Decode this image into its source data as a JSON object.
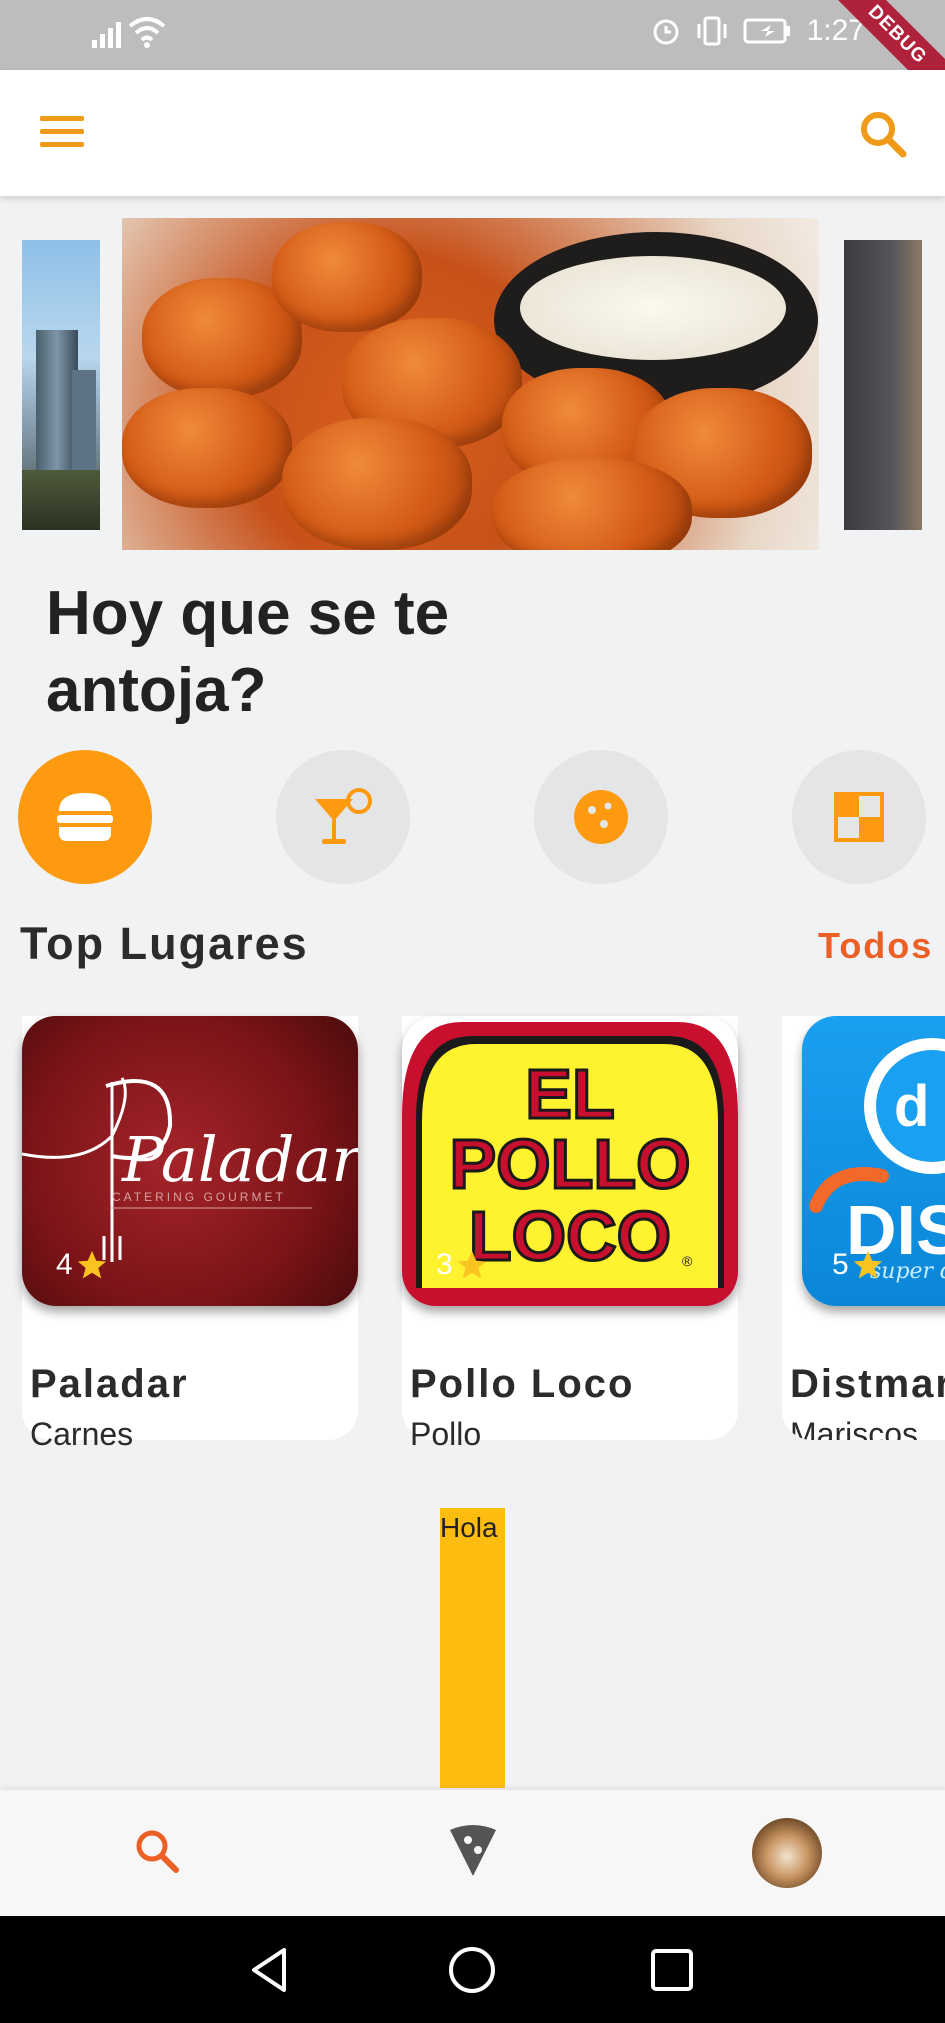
{
  "status_bar": {
    "time": "1:27",
    "debug_banner": "DEBUG",
    "icons": [
      "signal-icon",
      "wifi-icon",
      "alarm-icon",
      "vibrate-icon",
      "battery-icon"
    ]
  },
  "app_bar": {
    "icons": [
      "menu-icon",
      "search-icon"
    ],
    "accent_color": "#ef9a18"
  },
  "carousel": {
    "slides": [
      "city-skyline-image",
      "chicken-wings-image",
      "dark-image"
    ]
  },
  "headline": "Hoy que se te antoja?",
  "categories": [
    {
      "icon": "burger-icon",
      "active": true
    },
    {
      "icon": "cocktail-icon",
      "active": false
    },
    {
      "icon": "cookie-icon",
      "active": false
    },
    {
      "icon": "checkered-icon",
      "active": false
    }
  ],
  "section": {
    "title": "Top Lugares",
    "see_all": "Todos"
  },
  "places": [
    {
      "name": "Paladar",
      "category": "Carnes",
      "rating": "4",
      "logo_text": "Paladar",
      "logo_subtext": "CATERING GOURMET"
    },
    {
      "name": "Pollo Loco",
      "category": "Pollo",
      "rating": "3",
      "logo_text_line1": "EL",
      "logo_text_line2": "POLLO",
      "logo_text_line3": "LOCO",
      "logo_mark": "®"
    },
    {
      "name": "Distmar",
      "category": "Mariscos",
      "rating": "5",
      "logo_text": "DIST",
      "logo_subtext": "super d"
    }
  ],
  "hola_label": "Hola",
  "bottom_nav": {
    "items": [
      "search-icon",
      "pizza-icon",
      "avatar"
    ],
    "active_color": "#ec6026"
  },
  "system_nav": [
    "back-icon",
    "home-icon",
    "recents-icon"
  ],
  "colors": {
    "primary": "#fd9a10",
    "accent": "#ec6026",
    "background": "#f1f2f4",
    "bar": "#fdbd10"
  }
}
